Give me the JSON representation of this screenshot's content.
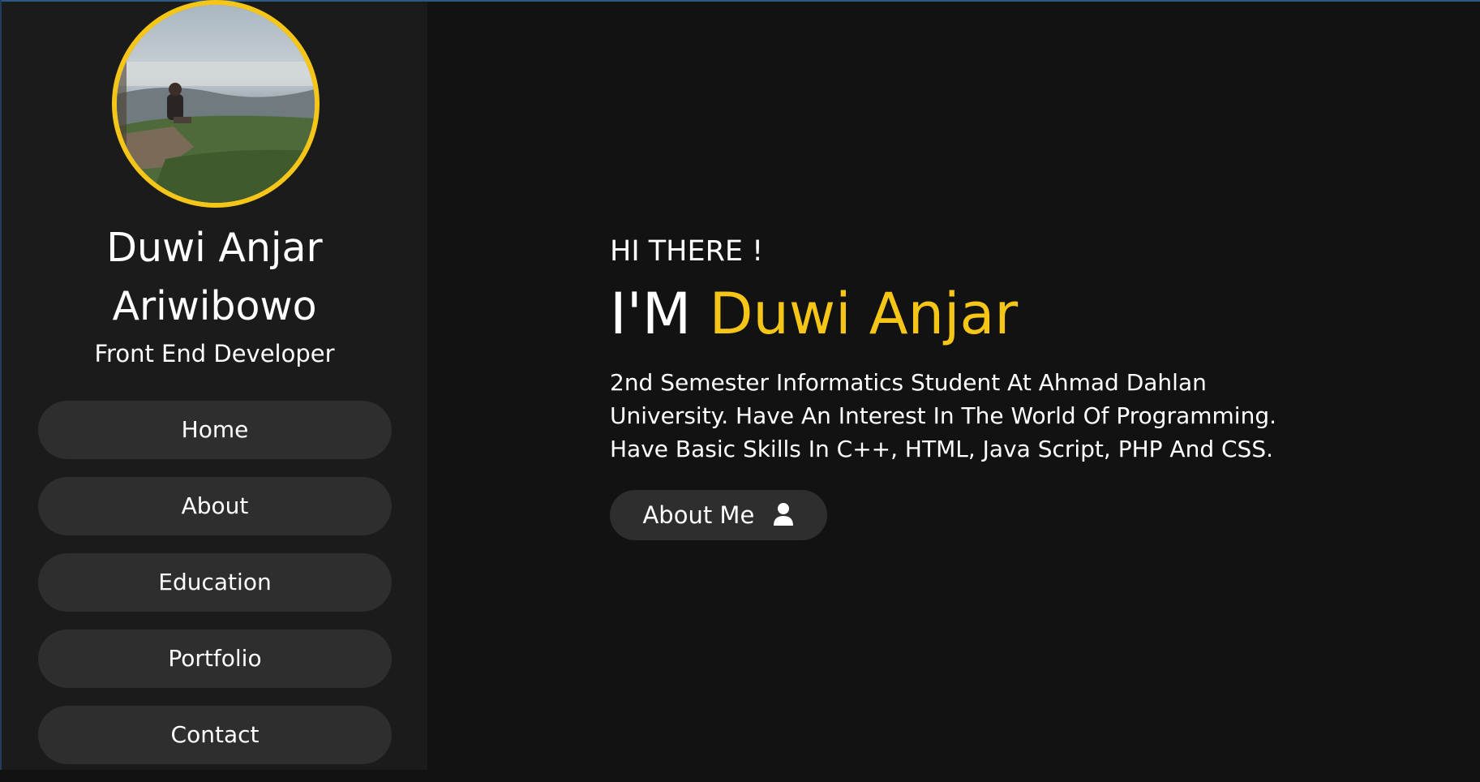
{
  "colors": {
    "background": "#121212",
    "sidebar": "#1b1b1b",
    "button": "#2e2e2e",
    "accent": "#f5c518",
    "text": "#ffffff"
  },
  "sidebar": {
    "avatar_icon": "profile-photo",
    "name_line1": "Duwi Anjar",
    "name_line2": "Ariwibowo",
    "role": "Front End Developer",
    "nav": [
      {
        "label": "Home"
      },
      {
        "label": "About"
      },
      {
        "label": "Education"
      },
      {
        "label": "Portfolio"
      },
      {
        "label": "Contact"
      }
    ]
  },
  "hero": {
    "greeting": "HI THERE !",
    "headline_prefix": "I'M",
    "headline_name": "Duwi Anjar",
    "description": "2nd Semester Informatics Student At Ahmad Dahlan University. Have An Interest In The World Of Programming. Have Basic Skills In C++, HTML, Java Script, PHP And CSS.",
    "button_label": "About Me",
    "button_icon": "user-icon"
  }
}
